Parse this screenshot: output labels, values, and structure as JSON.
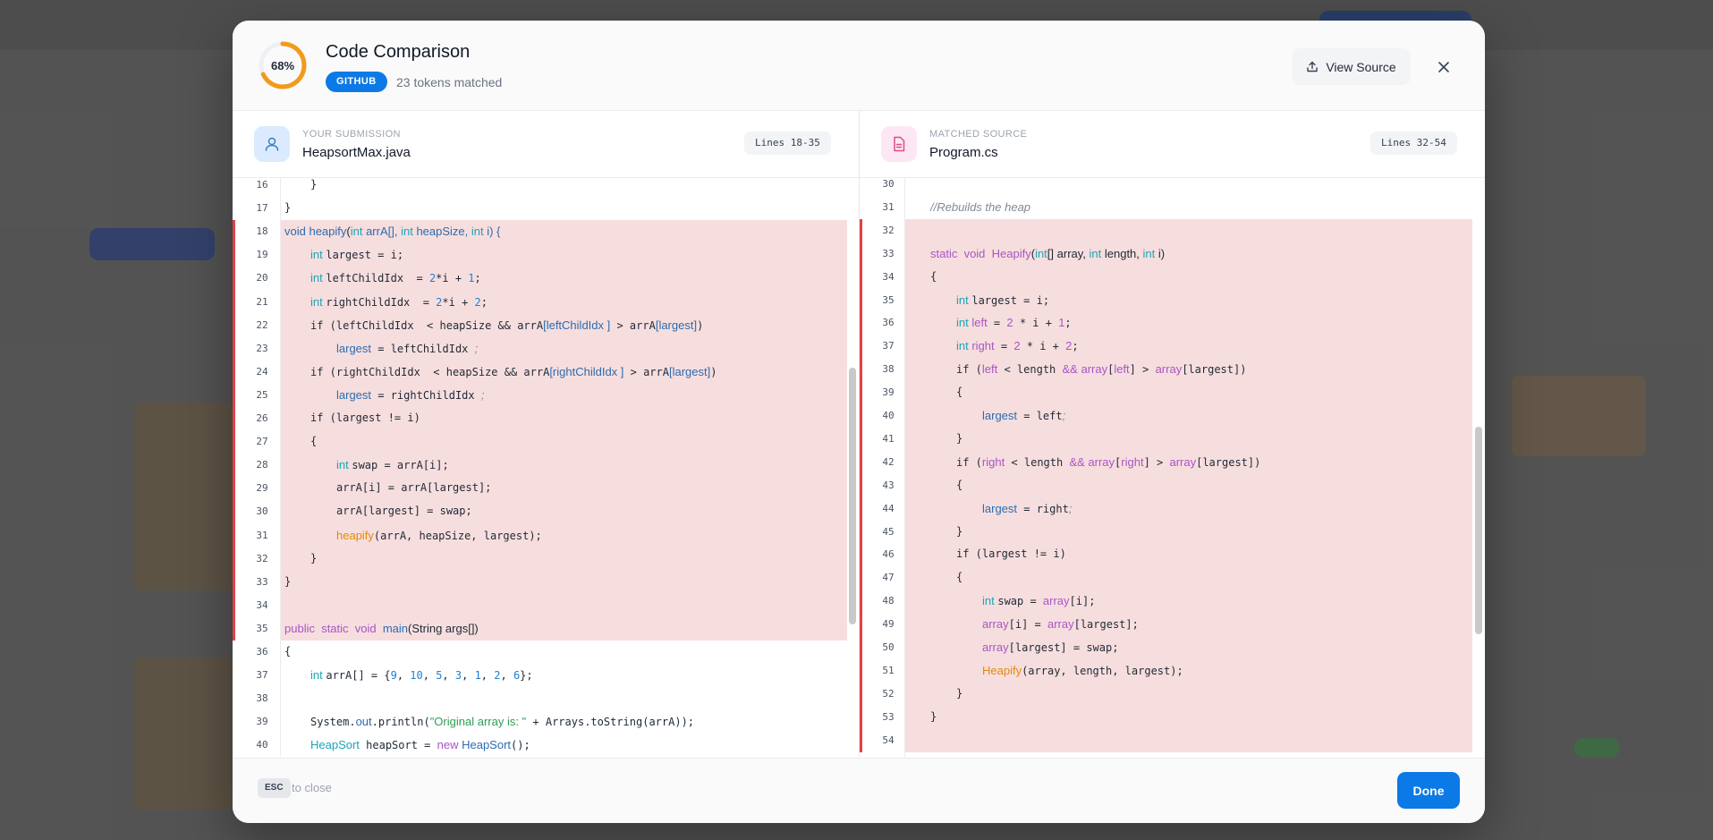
{
  "header": {
    "score": "68%",
    "score_fraction": 0.68,
    "title": "Code Comparison",
    "source_badge": "GITHUB",
    "tokens_matched": "23 tokens matched",
    "view_source_label": "View Source"
  },
  "colors": {
    "accent": "#0b7ae6",
    "score_ring": "#f29a1a",
    "highlight_bg": "#f7dede",
    "highlight_bar": "#e1424a"
  },
  "left": {
    "label": "YOUR SUBMISSION",
    "filename": "HeapsortMax.java",
    "lines_badge": "Lines 18-35",
    "icon": "user-icon",
    "highlight_from": 18,
    "highlight_to": 35,
    "lines": [
      {
        "n": "16",
        "indent": 2,
        "t": [
          [
            "}",
            ""
          ]
        ]
      },
      {
        "n": "17",
        "indent": 1,
        "t": [
          [
            "}",
            ""
          ]
        ]
      },
      {
        "n": "18",
        "indent": 1,
        "t": [
          [
            "void ",
            "fn"
          ],
          [
            "heapify",
            "fn"
          ],
          [
            "(",
            "txt"
          ],
          [
            "int ",
            "kw"
          ],
          [
            "arrA[], ",
            "fn"
          ],
          [
            "int ",
            "kw"
          ],
          [
            "heapSize, ",
            "fn"
          ],
          [
            "int ",
            "kw"
          ],
          [
            "i) {",
            "fn"
          ]
        ]
      },
      {
        "n": "19",
        "indent": 2,
        "t": [
          [
            "int ",
            "kw"
          ],
          [
            "largest = i;",
            ""
          ]
        ]
      },
      {
        "n": "20",
        "indent": 2,
        "t": [
          [
            "int ",
            "kw"
          ],
          [
            "leftChildIdx  = ",
            ""
          ],
          [
            "2",
            "num"
          ],
          [
            "*i + ",
            ""
          ],
          [
            "1",
            "num"
          ],
          [
            ";",
            ""
          ]
        ]
      },
      {
        "n": "21",
        "indent": 2,
        "t": [
          [
            "int ",
            "kw"
          ],
          [
            "rightChildIdx  = ",
            ""
          ],
          [
            "2",
            "num"
          ],
          [
            "*i + ",
            ""
          ],
          [
            "2",
            "num"
          ],
          [
            ";",
            ""
          ]
        ]
      },
      {
        "n": "22",
        "indent": 2,
        "t": [
          [
            "if (leftChildIdx  < heapSize && arrA",
            ""
          ],
          [
            "[leftChildIdx ]",
            "fn"
          ],
          [
            " > arrA",
            ""
          ],
          [
            "[largest]",
            "fn"
          ],
          [
            ")",
            ""
          ]
        ]
      },
      {
        "n": "23",
        "indent": 3,
        "t": [
          [
            "largest",
            "fn"
          ],
          [
            " = leftChildIdx ",
            ""
          ],
          [
            ";",
            "cmt"
          ]
        ]
      },
      {
        "n": "24",
        "indent": 2,
        "t": [
          [
            "if (rightChildIdx  < heapSize && arrA",
            ""
          ],
          [
            "[rightChildIdx ]",
            "fn"
          ],
          [
            " > arrA",
            ""
          ],
          [
            "[largest]",
            "fn"
          ],
          [
            ")",
            ""
          ]
        ]
      },
      {
        "n": "25",
        "indent": 3,
        "t": [
          [
            "largest",
            "fn"
          ],
          [
            " = rightChildIdx ",
            ""
          ],
          [
            ";",
            "cmt"
          ]
        ]
      },
      {
        "n": "26",
        "indent": 2,
        "t": [
          [
            "if (largest != i)",
            ""
          ]
        ]
      },
      {
        "n": "27",
        "indent": 2,
        "t": [
          [
            "{",
            ""
          ]
        ]
      },
      {
        "n": "28",
        "indent": 3,
        "t": [
          [
            "int ",
            "kw"
          ],
          [
            "swap = arrA[i];",
            ""
          ]
        ]
      },
      {
        "n": "29",
        "indent": 3,
        "t": [
          [
            "arrA[i] = arrA[largest];",
            ""
          ]
        ]
      },
      {
        "n": "30",
        "indent": 3,
        "t": [
          [
            "arrA[largest] = swap;",
            ""
          ]
        ]
      },
      {
        "n": "31",
        "indent": 3,
        "t": [
          [
            "heapify",
            "call"
          ],
          [
            "(arrA, heapSize, largest);",
            ""
          ]
        ]
      },
      {
        "n": "32",
        "indent": 2,
        "t": [
          [
            "}",
            ""
          ]
        ]
      },
      {
        "n": "33",
        "indent": 1,
        "t": [
          [
            "}",
            ""
          ]
        ]
      },
      {
        "n": "34",
        "indent": 0,
        "t": []
      },
      {
        "n": "35",
        "indent": 1,
        "t": [
          [
            "public  static  void  ",
            "sk"
          ],
          [
            "main",
            "fn"
          ],
          [
            "(String args[])",
            "txt"
          ]
        ]
      },
      {
        "n": "36",
        "indent": 1,
        "t": [
          [
            "{",
            ""
          ]
        ]
      },
      {
        "n": "37",
        "indent": 2,
        "t": [
          [
            "int ",
            "kw"
          ],
          [
            "arrA[] = {",
            ""
          ],
          [
            "9",
            "num"
          ],
          [
            ", ",
            ""
          ],
          [
            "10",
            "num"
          ],
          [
            ", ",
            ""
          ],
          [
            "5",
            "num"
          ],
          [
            ", ",
            ""
          ],
          [
            "3",
            "num"
          ],
          [
            ", ",
            ""
          ],
          [
            "1",
            "num"
          ],
          [
            ", ",
            ""
          ],
          [
            "2",
            "num"
          ],
          [
            ", ",
            ""
          ],
          [
            "6",
            "num"
          ],
          [
            "};",
            ""
          ]
        ]
      },
      {
        "n": "38",
        "indent": 0,
        "t": []
      },
      {
        "n": "39",
        "indent": 2,
        "t": [
          [
            "System.",
            ""
          ],
          [
            "out",
            "fn"
          ],
          [
            ".println(",
            ""
          ],
          [
            "\"Original array is: \"",
            "str"
          ],
          [
            " + Arrays.toString(arrA));",
            ""
          ]
        ]
      },
      {
        "n": "40",
        "indent": 2,
        "t": [
          [
            "HeapSort",
            "kw"
          ],
          [
            " heapSort = ",
            ""
          ],
          [
            "new ",
            "sk"
          ],
          [
            "HeapSort",
            "fn"
          ],
          [
            "();",
            ""
          ]
        ]
      }
    ]
  },
  "right": {
    "label": "MATCHED SOURCE",
    "filename": "Program.cs",
    "lines_badge": "Lines 32-54",
    "icon": "document-icon",
    "highlight_from": 32,
    "highlight_to": 54,
    "lines": [
      {
        "n": "30",
        "indent": 0,
        "t": []
      },
      {
        "n": "31",
        "indent": 2,
        "t": [
          [
            "//Rebuilds the heap",
            "cmt"
          ]
        ]
      },
      {
        "n": "32",
        "indent": 0,
        "t": []
      },
      {
        "n": "33",
        "indent": 2,
        "t": [
          [
            "static  void  ",
            "sk"
          ],
          [
            "Heapify",
            "sk"
          ],
          [
            "(",
            "txt"
          ],
          [
            "int",
            "kw"
          ],
          [
            "[] array, ",
            "txt"
          ],
          [
            "int ",
            "kw"
          ],
          [
            "length, ",
            "txt"
          ],
          [
            "int ",
            "kw"
          ],
          [
            "i)",
            "txt"
          ]
        ]
      },
      {
        "n": "34",
        "indent": 2,
        "t": [
          [
            "{",
            ""
          ]
        ]
      },
      {
        "n": "35",
        "indent": 3,
        "t": [
          [
            "int ",
            "kw"
          ],
          [
            "largest = i;",
            ""
          ]
        ]
      },
      {
        "n": "36",
        "indent": 3,
        "t": [
          [
            "int ",
            "kw"
          ],
          [
            "left",
            "sk"
          ],
          [
            " = ",
            ""
          ],
          [
            "2",
            "sk"
          ],
          [
            " * i + ",
            ""
          ],
          [
            "1",
            "sk"
          ],
          [
            ";",
            ""
          ]
        ]
      },
      {
        "n": "37",
        "indent": 3,
        "t": [
          [
            "int ",
            "kw"
          ],
          [
            "right",
            "sk"
          ],
          [
            " = ",
            ""
          ],
          [
            "2",
            "sk"
          ],
          [
            " * i + ",
            ""
          ],
          [
            "2",
            "sk"
          ],
          [
            ";",
            ""
          ]
        ]
      },
      {
        "n": "38",
        "indent": 3,
        "t": [
          [
            "if (",
            ""
          ],
          [
            "left",
            "sk"
          ],
          [
            " < length ",
            ""
          ],
          [
            "&& ",
            "sk"
          ],
          [
            "array",
            "sk"
          ],
          [
            "[",
            ""
          ],
          [
            "left",
            "sk"
          ],
          [
            "] > ",
            ""
          ],
          [
            "array",
            "sk"
          ],
          [
            "[largest])",
            ""
          ]
        ]
      },
      {
        "n": "39",
        "indent": 3,
        "t": [
          [
            "{",
            ""
          ]
        ]
      },
      {
        "n": "40",
        "indent": 4,
        "t": [
          [
            "largest",
            "fn"
          ],
          [
            " = left",
            ""
          ],
          [
            ";",
            "cmt"
          ]
        ]
      },
      {
        "n": "41",
        "indent": 3,
        "t": [
          [
            "}",
            ""
          ]
        ]
      },
      {
        "n": "42",
        "indent": 3,
        "t": [
          [
            "if (",
            ""
          ],
          [
            "right",
            "sk"
          ],
          [
            " < length ",
            ""
          ],
          [
            "&& ",
            "sk"
          ],
          [
            "array",
            "sk"
          ],
          [
            "[",
            ""
          ],
          [
            "right",
            "sk"
          ],
          [
            "] > ",
            ""
          ],
          [
            "array",
            "sk"
          ],
          [
            "[largest])",
            ""
          ]
        ]
      },
      {
        "n": "43",
        "indent": 3,
        "t": [
          [
            "{",
            ""
          ]
        ]
      },
      {
        "n": "44",
        "indent": 4,
        "t": [
          [
            "largest",
            "fn"
          ],
          [
            " = right",
            ""
          ],
          [
            ";",
            "cmt"
          ]
        ]
      },
      {
        "n": "45",
        "indent": 3,
        "t": [
          [
            "}",
            ""
          ]
        ]
      },
      {
        "n": "46",
        "indent": 3,
        "t": [
          [
            "if (largest != i)",
            ""
          ]
        ]
      },
      {
        "n": "47",
        "indent": 3,
        "t": [
          [
            "{",
            ""
          ]
        ]
      },
      {
        "n": "48",
        "indent": 4,
        "t": [
          [
            "int ",
            "kw"
          ],
          [
            "swap = ",
            ""
          ],
          [
            "array",
            "sk"
          ],
          [
            "[i];",
            ""
          ]
        ]
      },
      {
        "n": "49",
        "indent": 4,
        "t": [
          [
            "array",
            "sk"
          ],
          [
            "[i] = ",
            ""
          ],
          [
            "array",
            "sk"
          ],
          [
            "[largest];",
            ""
          ]
        ]
      },
      {
        "n": "50",
        "indent": 4,
        "t": [
          [
            "array",
            "sk"
          ],
          [
            "[largest] = swap;",
            ""
          ]
        ]
      },
      {
        "n": "51",
        "indent": 4,
        "t": [
          [
            "Heapify",
            "call"
          ],
          [
            "(array, length, largest);",
            ""
          ]
        ]
      },
      {
        "n": "52",
        "indent": 3,
        "t": [
          [
            "}",
            ""
          ]
        ]
      },
      {
        "n": "53",
        "indent": 2,
        "t": [
          [
            "}",
            ""
          ]
        ]
      },
      {
        "n": "54",
        "indent": 0,
        "t": []
      }
    ]
  },
  "footer": {
    "kbd": "ESC",
    "hint": "to close",
    "done_label": "Done"
  }
}
